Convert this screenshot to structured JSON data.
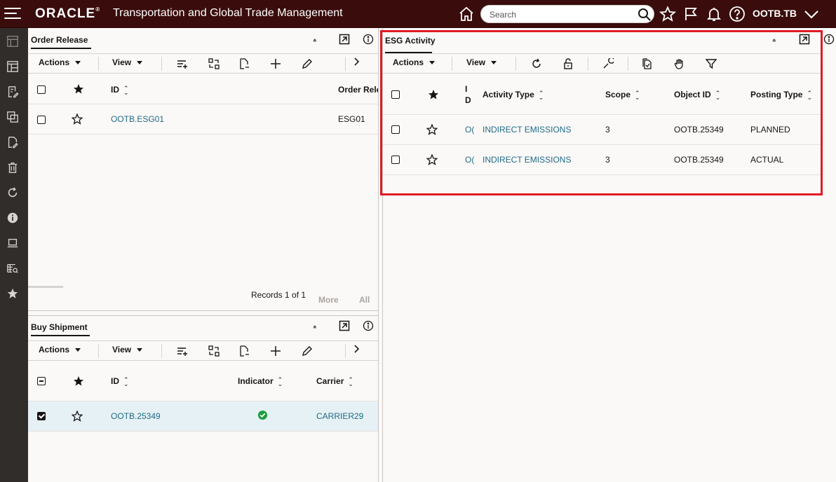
{
  "header": {
    "logo": "ORACLE",
    "logo_mark": "®",
    "app_title": "Transportation and Global Trade Management",
    "search_placeholder": "Search",
    "user": "OOTB.TB"
  },
  "order_release": {
    "title": "Order Release",
    "toolbar": {
      "actions": "Actions",
      "view": "View"
    },
    "columns": {
      "id": "ID",
      "order_release": "Order Rele"
    },
    "rows": [
      {
        "id": "OOTB.ESG01",
        "order_release": "ESG01"
      }
    ],
    "records": "Records 1 of 1",
    "more": "More",
    "all": "All"
  },
  "buy_shipment": {
    "title": "Buy Shipment",
    "toolbar": {
      "actions": "Actions",
      "view": "View"
    },
    "columns": {
      "id": "ID",
      "indicator": "Indicator",
      "carrier": "Carrier"
    },
    "rows": [
      {
        "id": "OOTB.25349",
        "carrier": "CARRIER29",
        "indicator_color": "#1f9d3e"
      }
    ]
  },
  "esg_activity": {
    "title": "ESG Activity",
    "toolbar": {
      "actions": "Actions",
      "view": "View"
    },
    "columns": {
      "id_top": "I",
      "id_bottom": "D",
      "activity_type": "Activity Type",
      "scope": "Scope",
      "object_id": "Object ID",
      "posting_type": "Posting Type"
    },
    "rows": [
      {
        "id": "O(",
        "activity_type": "INDIRECT EMISSIONS",
        "scope": "3",
        "object_id": "OOTB.25349",
        "posting_type": "PLANNED"
      },
      {
        "id": "O(",
        "activity_type": "INDIRECT EMISSIONS",
        "scope": "3",
        "object_id": "OOTB.25349",
        "posting_type": "ACTUAL"
      }
    ]
  },
  "colors": {
    "header_bg": "#3a0c0c",
    "rail_bg": "#312d2a",
    "link": "#1f6a87",
    "highlight": "#e01b24"
  }
}
